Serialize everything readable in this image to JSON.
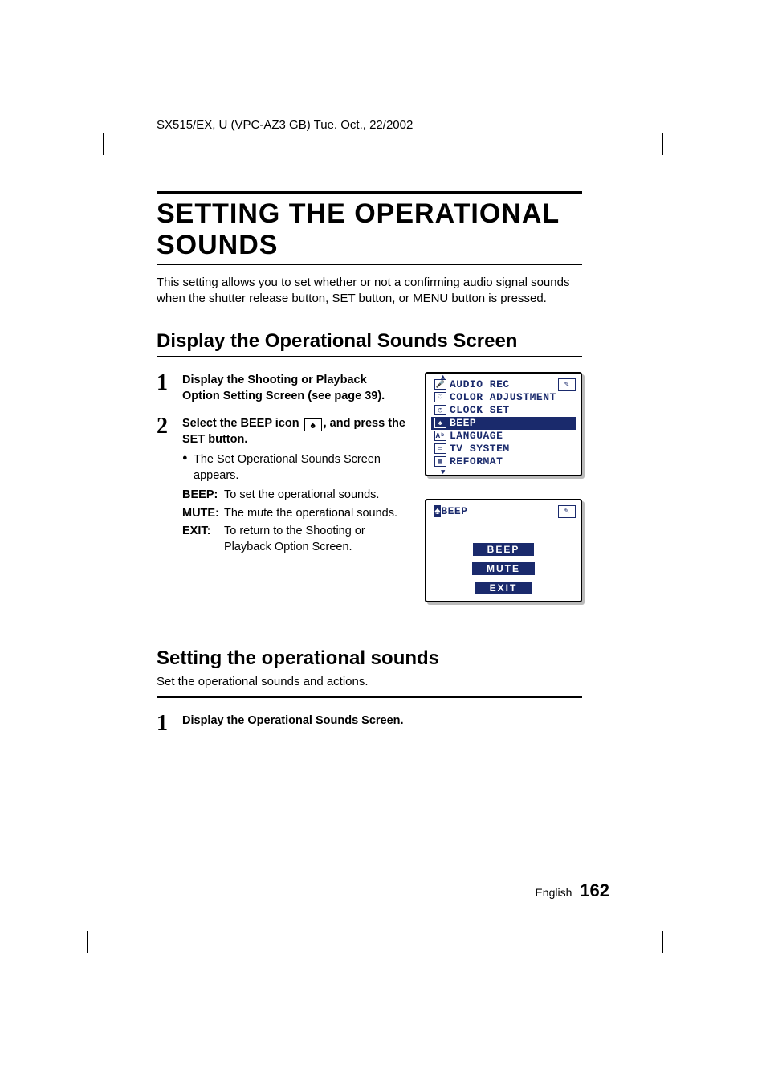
{
  "header": "SX515/EX, U (VPC-AZ3 GB)    Tue. Oct., 22/2002",
  "title": "SETTING THE OPERATIONAL SOUNDS",
  "intro": "This setting allows you to set whether or not a confirming audio signal sounds when the shutter release button, SET button, or MENU button is pressed.",
  "section1_heading": "Display the Operational Sounds Screen",
  "step1_num": "1",
  "step1_text": "Display the Shooting or Playback Option Setting Screen (see page 39).",
  "step2_num": "2",
  "step2_a": "Select the BEEP icon ",
  "step2_b": ", and press the SET button.",
  "step2_bullet": "The Set Operational Sounds Screen appears.",
  "defs": {
    "beep_term": "BEEP:",
    "beep_desc": "To set the operational sounds.",
    "mute_term": "MUTE:",
    "mute_desc": "The mute the operational sounds.",
    "exit_term": "EXIT:",
    "exit_desc": "To return to the Shooting or Playback Option Screen."
  },
  "lcd_menu": {
    "items": [
      {
        "icon": "🎤",
        "label": "AUDIO REC"
      },
      {
        "icon": "♡",
        "label": "COLOR ADJUSTMENT"
      },
      {
        "icon": "◷",
        "label": "CLOCK SET"
      },
      {
        "icon": "♠",
        "label": "BEEP"
      },
      {
        "icon": "Aᵇ",
        "label": "LANGUAGE"
      },
      {
        "icon": "▭",
        "label": "TV SYSTEM"
      },
      {
        "icon": "▦",
        "label": "REFORMAT"
      }
    ],
    "selected_index": 3
  },
  "lcd_beep": {
    "title": "BEEP",
    "options": [
      "BEEP",
      "MUTE",
      "EXIT"
    ]
  },
  "section2_heading": "Setting the operational sounds",
  "section2_sub": "Set the operational sounds and actions.",
  "section2_step1_num": "1",
  "section2_step1_text": "Display the Operational Sounds Screen.",
  "footer_lang": "English",
  "footer_page": "162"
}
